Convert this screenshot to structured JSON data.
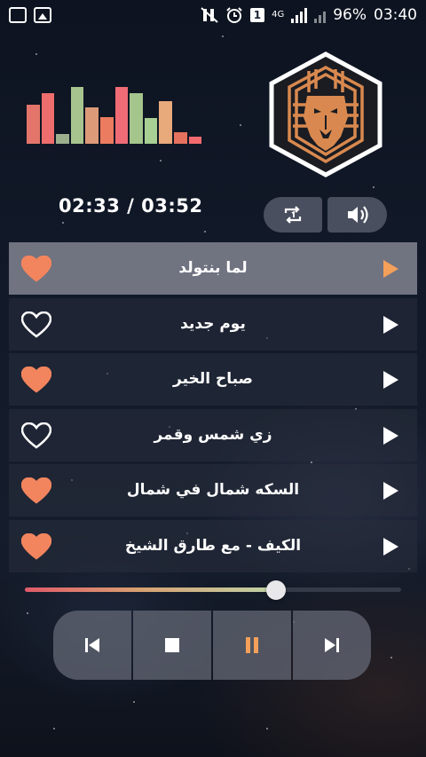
{
  "status_bar": {
    "left_icons": [
      "image-icon",
      "gallery-icon"
    ],
    "right_icons": [
      "mute-icon",
      "alarm-icon",
      "sim-icon",
      "signal-icon",
      "signal-icon"
    ],
    "sim_slot": "1",
    "network": "4G",
    "battery": "96%",
    "clock": "03:40"
  },
  "equalizer": {
    "levels": [
      0.66,
      0.86,
      0.17,
      0.97,
      0.62,
      0.45,
      0.97,
      0.86,
      0.44,
      0.73,
      0.2,
      0.12
    ],
    "colors": [
      "#e4756b",
      "#ee6d6d",
      "#9cb08e",
      "#a8c48e",
      "#dc9a78",
      "#ec7c5f",
      "#ef6b75",
      "#a4c58c",
      "#a8cf94",
      "#e8a97b",
      "#e4725f",
      "#f26a6e"
    ]
  },
  "player": {
    "current_time": "02:33",
    "duration": "03:52",
    "time_display": "02:33 / 03:52",
    "progress": 0.667,
    "repeat_icon": "repeat-one-icon",
    "volume_icon": "volume-icon"
  },
  "playlist": [
    {
      "title": "لما بنتولد",
      "favorite": true,
      "active": true
    },
    {
      "title": "يوم جديد",
      "favorite": false,
      "active": false
    },
    {
      "title": "صباح الخير",
      "favorite": true,
      "active": false
    },
    {
      "title": "زي شمس وقمر",
      "favorite": false,
      "active": false
    },
    {
      "title": "السكه شمال في شمال",
      "favorite": true,
      "active": false
    },
    {
      "title": "الكيف - مع طارق الشيخ",
      "favorite": true,
      "active": false
    }
  ],
  "transport": [
    "skip-previous-icon",
    "stop-icon",
    "pause-icon",
    "skip-next-icon"
  ],
  "colors": {
    "accent": "#f4a05a",
    "heart": "#f2855e",
    "active_row": "#96969f",
    "logo_gold": "#d9894f"
  }
}
